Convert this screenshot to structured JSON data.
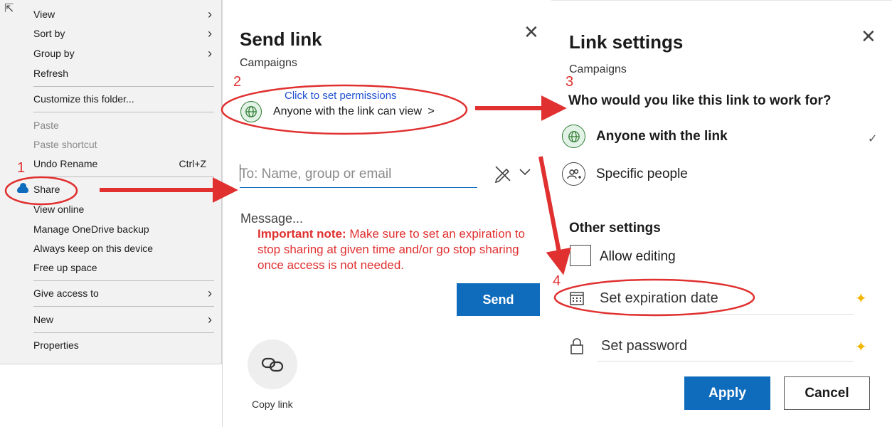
{
  "context_menu": {
    "items": [
      {
        "label": "View",
        "shortcut": "",
        "submenu": true,
        "disabled": false
      },
      {
        "label": "Sort by",
        "shortcut": "",
        "submenu": true,
        "disabled": false
      },
      {
        "label": "Group by",
        "shortcut": "",
        "submenu": true,
        "disabled": false
      },
      {
        "label": "Refresh",
        "shortcut": "",
        "submenu": false,
        "disabled": false
      },
      {
        "label": "Customize this folder...",
        "shortcut": "",
        "submenu": false,
        "disabled": false
      },
      {
        "label": "Paste",
        "shortcut": "",
        "submenu": false,
        "disabled": true
      },
      {
        "label": "Paste shortcut",
        "shortcut": "",
        "submenu": false,
        "disabled": true
      },
      {
        "label": "Undo Rename",
        "shortcut": "Ctrl+Z",
        "submenu": false,
        "disabled": false
      },
      {
        "label": "Share",
        "shortcut": "",
        "submenu": false,
        "disabled": false,
        "icon": "onedrive-cloud-icon"
      },
      {
        "label": "View online",
        "shortcut": "",
        "submenu": false,
        "disabled": false
      },
      {
        "label": "Manage OneDrive backup",
        "shortcut": "",
        "submenu": false,
        "disabled": false
      },
      {
        "label": "Always keep on this device",
        "shortcut": "",
        "submenu": false,
        "disabled": false
      },
      {
        "label": "Free up space",
        "shortcut": "",
        "submenu": false,
        "disabled": false
      },
      {
        "label": "Give access to",
        "shortcut": "",
        "submenu": true,
        "disabled": false
      },
      {
        "label": "New",
        "shortcut": "",
        "submenu": true,
        "disabled": false
      },
      {
        "label": "Properties",
        "shortcut": "",
        "submenu": false,
        "disabled": false
      }
    ]
  },
  "send_link": {
    "title": "Send link",
    "folder": "Campaigns",
    "permission": "Anyone with the link can view",
    "permission_chevron": ">",
    "to_placeholder": "To: Name, group or email",
    "message_placeholder": "Message...",
    "send_label": "Send",
    "copy_link_label": "Copy link",
    "close": "✕"
  },
  "link_settings": {
    "title": "Link settings",
    "folder": "Campaigns",
    "question": "Who would you like this link to work for?",
    "options": [
      {
        "label": "Anyone with the link",
        "selected": true
      },
      {
        "label": "Specific people",
        "selected": false
      }
    ],
    "check": "✓",
    "other_settings_heading": "Other settings",
    "allow_editing_label": "Allow editing",
    "expiration_label": "Set expiration date",
    "password_label": "Set password",
    "sparkle": "✦",
    "apply_label": "Apply",
    "cancel_label": "Cancel",
    "close": "✕"
  },
  "annotations": {
    "steps": [
      "1",
      "2",
      "3",
      "4"
    ],
    "permission_hint": "Click to set permissions",
    "note_bold": "Important note:",
    "note_text": " Make sure to set an expiration to stop sharing at given time and/or go stop sharing once access is not needed."
  },
  "colors": {
    "accent": "#0f6cbd",
    "annotation_red": "#e03030",
    "hint_blue": "#1e4fd1",
    "sparkle_yellow": "#f2b705"
  }
}
